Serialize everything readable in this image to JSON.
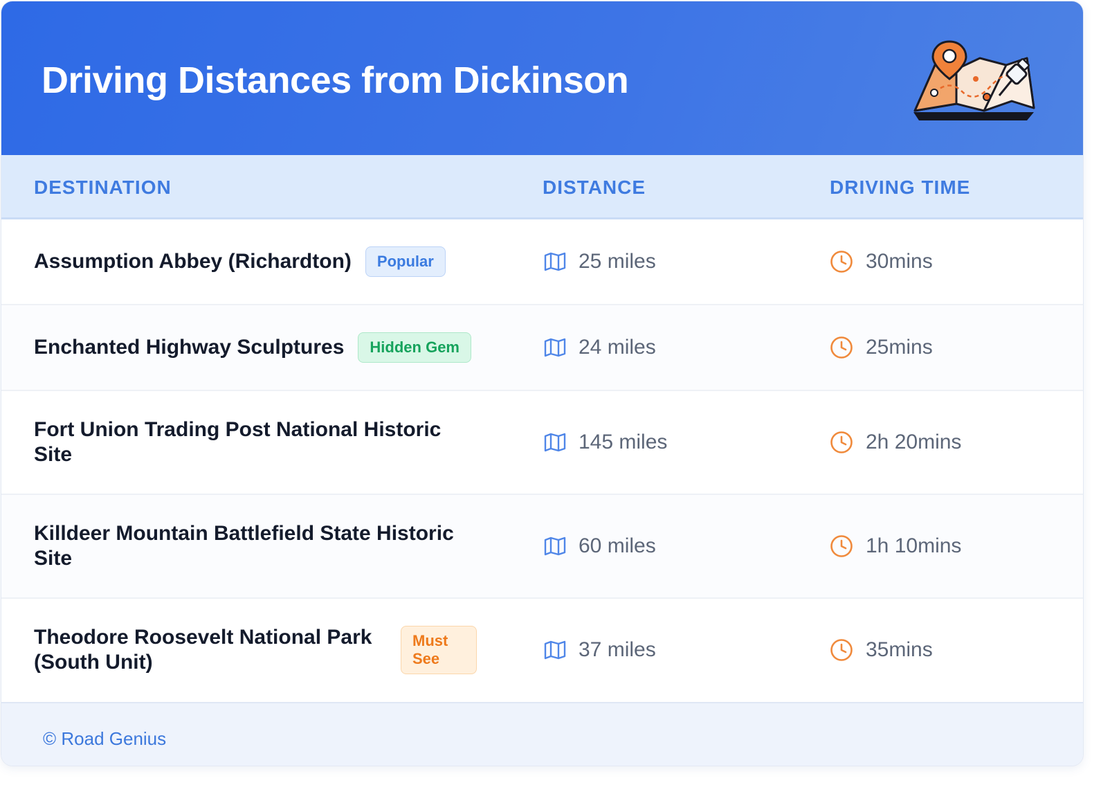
{
  "header": {
    "title": "Driving Distances from Dickinson"
  },
  "columns": {
    "destination": "DESTINATION",
    "distance": "DISTANCE",
    "driving_time": "DRIVING TIME"
  },
  "rows": [
    {
      "destination": "Assumption Abbey (Richardton)",
      "badge": "Popular",
      "distance": "25 miles",
      "time": "30mins"
    },
    {
      "destination": "Enchanted Highway Sculptures",
      "badge": "Hidden Gem",
      "distance": "24 miles",
      "time": "25mins"
    },
    {
      "destination": "Fort Union Trading Post National Historic Site",
      "distance": "145 miles",
      "time": "2h 20mins"
    },
    {
      "destination": "Killdeer Mountain Battlefield State Historic Site",
      "distance": "60 miles",
      "time": "1h 10mins"
    },
    {
      "destination": "Theodore Roosevelt National Park (South Unit)",
      "badge": "Must See",
      "distance": "37 miles",
      "time": "35mins"
    }
  ],
  "icons": {
    "header": "map-pin-illustration",
    "distance": "map-icon",
    "time": "clock-icon"
  },
  "colors": {
    "header_bg": "#2e6ae6",
    "accent": "#3f7be0",
    "badge_popular": "#3b7be0",
    "badge_hidden_gem": "#16a35c",
    "badge_must_see": "#ee7a1c",
    "clock": "#f08a3c",
    "map_icon": "#4f86e8"
  },
  "footer": {
    "copyright": "© Road Genius"
  }
}
